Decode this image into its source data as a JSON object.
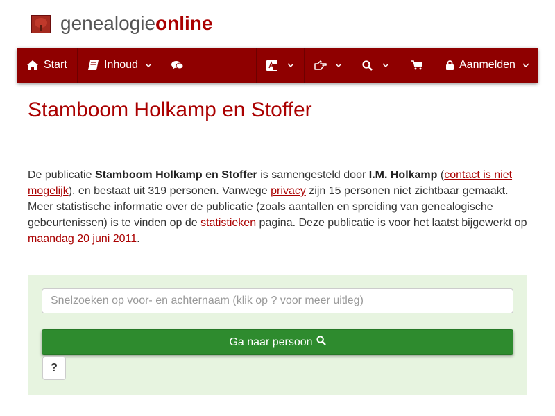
{
  "brand": {
    "part1": "genealogie",
    "part2": "online"
  },
  "nav": {
    "start": "Start",
    "inhoud": "Inhoud",
    "aanmelden": "Aanmelden",
    "icons": [
      "home-icon",
      "book-icon",
      "comments-icon",
      "language-icon",
      "hand-point-icon",
      "search-icon",
      "cart-icon",
      "lock-icon"
    ]
  },
  "page": {
    "title": "Stamboom Holkamp en Stoffer"
  },
  "intro": {
    "t1": "De publicatie ",
    "pub": "Stamboom Holkamp en Stoffer",
    "t2": " is samengesteld door ",
    "author": "I.M. Holkamp",
    "t3": " (",
    "contact_link": "contact is niet mogelijk",
    "t4": "). en bestaat uit 319 personen. Vanwege ",
    "privacy_link": "privacy",
    "t5": " zijn 15 personen niet zichtbaar gemaakt. Meer statistische informatie over de publicatie (zoals aantallen en spreiding van genealogische gebeurtenissen) is te vinden op de ",
    "stats_link": "statistieken",
    "t6": " pagina. Deze publicatie is voor het laatst bijgewerkt op ",
    "date_link": "maandag 20 juni 2011",
    "t7": "."
  },
  "search": {
    "placeholder": "Snelzoeken op voor- en achternaam (klik op ? voor meer uitleg)",
    "value": "",
    "go_label": "Ga naar persoon",
    "help_label": "?"
  },
  "colors": {
    "accent": "#a00000",
    "nav": "#8f0000",
    "go": "#2e8b2e",
    "panel": "#e7f4e0"
  }
}
